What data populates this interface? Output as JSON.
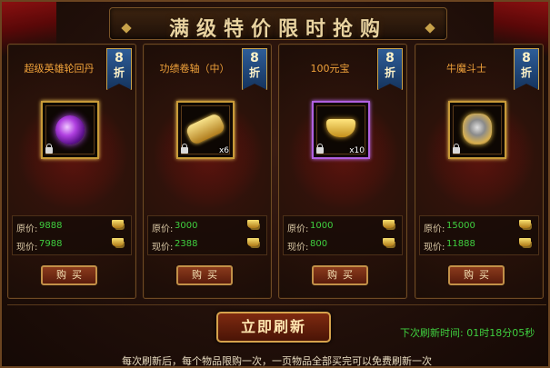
{
  "title": "满级特价限时抢购",
  "cards": [
    {
      "name": "超级英雄轮回丹",
      "discount_num": "8",
      "discount_unit": "折",
      "qty": "",
      "original_label": "原价:",
      "original": "9888",
      "current_label": "现价:",
      "current": "7988",
      "buy_label": "购买",
      "icon": "purple-orb-icon"
    },
    {
      "name": "功绩卷轴（中）",
      "discount_num": "8",
      "discount_unit": "折",
      "qty": "x6",
      "original_label": "原价:",
      "original": "3000",
      "current_label": "现价:",
      "current": "2388",
      "buy_label": "购买",
      "icon": "gold-scroll-icon"
    },
    {
      "name": "100元宝",
      "discount_num": "8",
      "discount_unit": "折",
      "qty": "x10",
      "original_label": "原价:",
      "original": "1000",
      "current_label": "现价:",
      "current": "800",
      "buy_label": "购买",
      "icon": "gold-ingot-icon"
    },
    {
      "name": "牛魔斗士",
      "discount_num": "8",
      "discount_unit": "折",
      "qty": "",
      "original_label": "原价:",
      "original": "15000",
      "current_label": "现价:",
      "current": "11888",
      "buy_label": "购买",
      "icon": "bull-demon-icon"
    }
  ],
  "refresh_label": "立即刷新",
  "timer_label": "下次刷新时间:",
  "timer_value": "01时18分05秒",
  "note": "每次刷新后，每个物品限购一次，一页物品全部买完可以免费刷新一次",
  "colors": {
    "accent_gold": "#c89a38",
    "price_green": "#3fcf3f",
    "name_orange": "#f0a23a",
    "badge_blue": "#2e5d98"
  }
}
